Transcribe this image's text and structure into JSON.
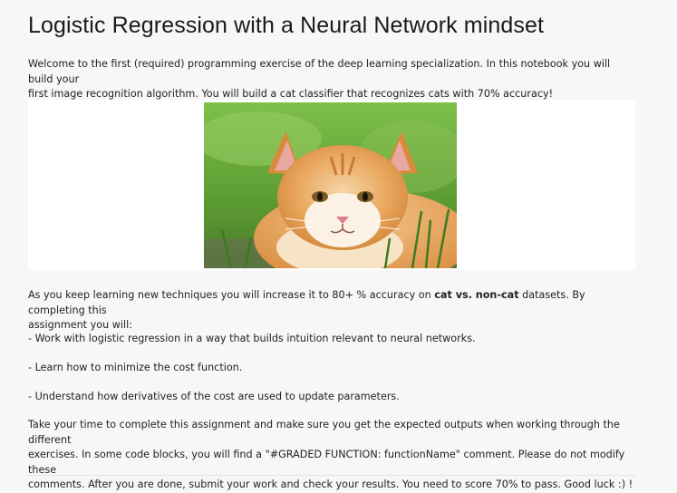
{
  "notebook": {
    "title": "Logistic Regression with a Neural Network mindset",
    "intro_line1": "Welcome to the first (required) programming exercise of the deep learning specialization. In this notebook you will build your",
    "intro_line2": "first image recognition algorithm. You will build a cat classifier that recognizes cats with 70% accuracy!",
    "image": {
      "subject": "cat"
    },
    "learning": {
      "line1_pre": "As you keep learning new techniques you will increase it to 80+ % accuracy on ",
      "line1_bold": "cat vs. non-cat",
      "line1_post": " datasets. By completing this",
      "line2": "assignment you will:"
    },
    "bullets": [
      "- Work with logistic regression in a way that builds intuition relevant to neural networks.",
      "- Learn how to minimize the cost function.",
      "- Understand how derivatives of the cost are used to update parameters."
    ],
    "closing": {
      "line1": "Take your time to complete this assignment and make sure you get the expected outputs when working through the different",
      "line2": "exercises. In some code blocks, you will find a \"#GRADED FUNCTION: functionName\" comment. Please do not modify these",
      "line3": "comments. After you are done, submit your work and check your results. You need to score 70% to pass. Good luck :) !"
    }
  }
}
